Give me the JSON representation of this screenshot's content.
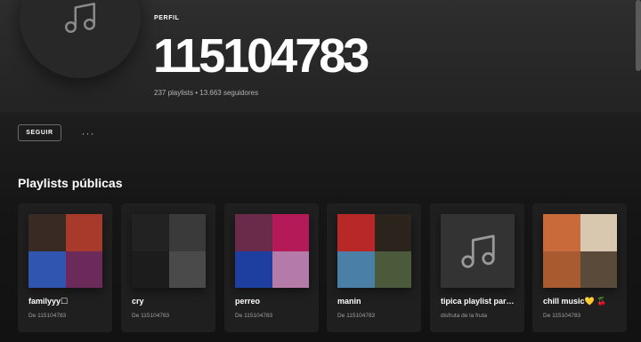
{
  "profile": {
    "kind_label": "PERFIL",
    "name": "115104783",
    "meta": "237 playlists • 13.663 seguidores",
    "avatar_icon": "music-note-icon"
  },
  "actions": {
    "follow_label": "SEGUIR",
    "more_label": "···"
  },
  "section": {
    "title": "Playlists públicas"
  },
  "playlists": [
    {
      "title": "familyyy☐",
      "subtitle": "De 115104783",
      "cover": [
        "#3a2a24",
        "#a83a2c",
        "#2f55b0",
        "#6b2a5a"
      ]
    },
    {
      "title": "cry",
      "subtitle": "De 115104783",
      "cover": [
        "#222222",
        "#3a3a3a",
        "#1c1c1c",
        "#4a4a4a"
      ]
    },
    {
      "title": "perreo",
      "subtitle": "De 115104783",
      "cover": [
        "#6a2a4a",
        "#b51a58",
        "#1f3fa0",
        "#b47aa8"
      ]
    },
    {
      "title": "manin",
      "subtitle": "De 115104783",
      "cover": [
        "#b82828",
        "#2a241c",
        "#4a80a8",
        "#4a5a3a"
      ]
    },
    {
      "title": "tipica playlist para ...",
      "subtitle": "disfruta de la fruta",
      "cover": [],
      "cover_icon": "music-note-icon"
    },
    {
      "title": "chill music💛 🍒",
      "subtitle": "De 115104783",
      "cover": [
        "#c86a3a",
        "#d8c8b0",
        "#a85a30",
        "#5a4a3a"
      ]
    }
  ],
  "colors": {
    "background": "#121212",
    "card": "#1f1f1f",
    "muted_text": "#b3b3b3"
  }
}
